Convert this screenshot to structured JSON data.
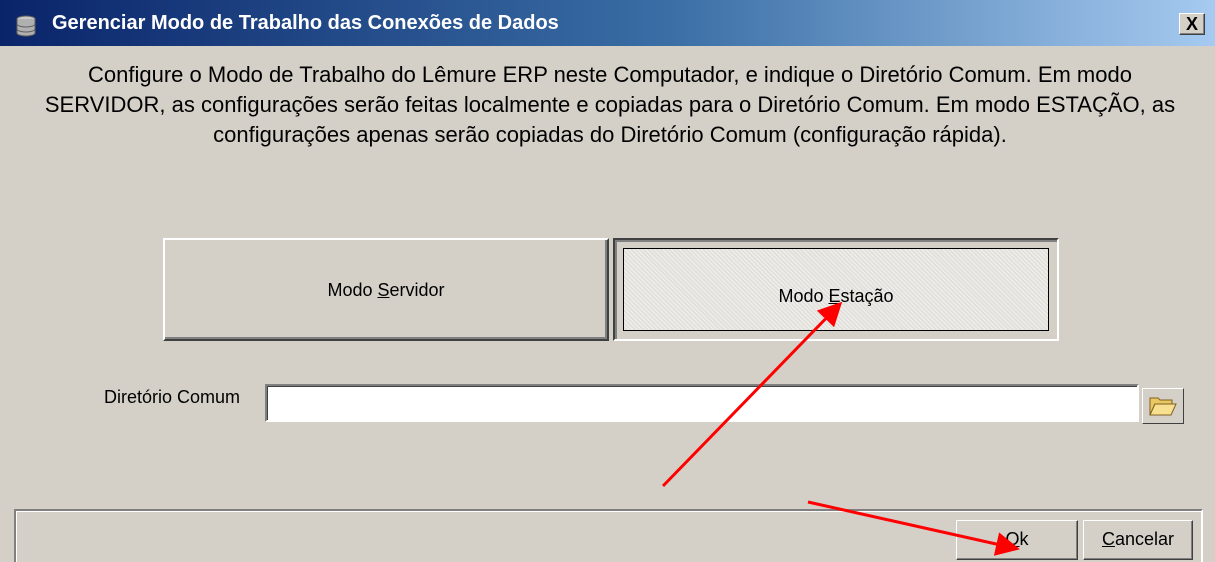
{
  "window": {
    "title": "Gerenciar Modo de Trabalho das Conexões de Dados",
    "icon": "database-icon",
    "close_label": "X"
  },
  "description": "Configure o Modo de Trabalho do Lêmure ERP neste Computador, e indique o Diretório Comum. Em modo SERVIDOR, as configurações serão feitas localmente e copiadas para o Diretório Comum. Em modo ESTAÇÃO, as configurações apenas serão copiadas do Diretório Comum (configuração rápida).",
  "modes": {
    "servidor": {
      "pre": "Modo ",
      "accel": "S",
      "post": "ervidor",
      "pressed": false
    },
    "estacao": {
      "pre": "Modo ",
      "accel": "E",
      "post": "stação",
      "pressed": true
    }
  },
  "diretorio": {
    "label": "Diretório Comum",
    "value": "",
    "browse_icon": "folder-open-icon"
  },
  "buttons": {
    "ok": {
      "accel": "O",
      "rest": "k"
    },
    "cancel": {
      "accel": "C",
      "rest": "ancelar"
    }
  },
  "annotations": {
    "arrow_color": "#ff0000"
  },
  "colors": {
    "window_bg": "#d4d0c8",
    "titlebar_start": "#0a246a",
    "titlebar_end": "#a6caf0"
  }
}
